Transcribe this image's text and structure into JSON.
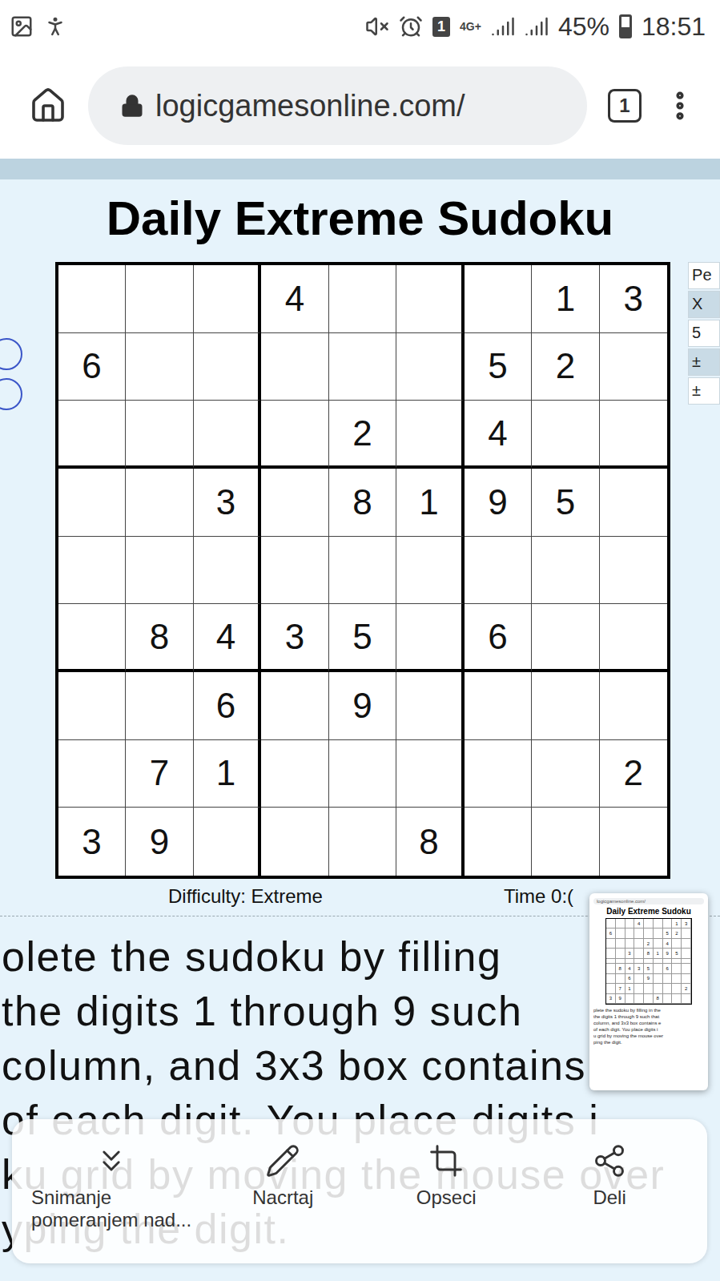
{
  "status_bar": {
    "sim_badge": "1",
    "network": "4G+",
    "battery": "45%",
    "time": "18:51"
  },
  "browser": {
    "url": "logicgamesonline.com/",
    "tab_count": "1"
  },
  "page": {
    "title": "Daily Extreme Sudoku",
    "side_panel": [
      "Pe",
      "X",
      "5",
      "±",
      "±"
    ],
    "difficulty": "Difficulty: Extreme",
    "time": "Time 0:("
  },
  "board": {
    "rows": [
      [
        "",
        "",
        "",
        "4",
        "",
        "",
        "",
        "1",
        "3"
      ],
      [
        "6",
        "",
        "",
        "",
        "",
        "",
        "5",
        "2",
        ""
      ],
      [
        "",
        "",
        "",
        "",
        "2",
        "",
        "4",
        "",
        ""
      ],
      [
        "",
        "",
        "3",
        "",
        "8",
        "1",
        "9",
        "5",
        ""
      ],
      [
        "",
        "",
        "",
        "",
        "",
        "",
        "",
        "",
        ""
      ],
      [
        "",
        "8",
        "4",
        "3",
        "5",
        "",
        "6",
        "",
        ""
      ],
      [
        "",
        "",
        "6",
        "",
        "9",
        "",
        "",
        "",
        ""
      ],
      [
        "",
        "7",
        "1",
        "",
        "",
        "",
        "",
        "",
        "2"
      ],
      [
        "3",
        "9",
        "",
        "",
        "",
        "8",
        "",
        "",
        ""
      ]
    ]
  },
  "instructions": [
    "olete the sudoku by filling",
    "the digits 1 through 9 such",
    "column, and 3x3 box contains e",
    "of each digit. You place digits i",
    "ku grid by moving the mouse over",
    "yping the digit."
  ],
  "screenshot_preview": {
    "title": "Daily Extreme Sudoku",
    "lines": [
      "plete the sudoku by filling in the",
      "the digits 1 through 9 such that",
      "column, and 3x3 box contains e",
      "of each digit. You place digits i",
      "u grid by moving the mouse over",
      "ping the digit."
    ]
  },
  "share_toolbar": {
    "items": [
      {
        "kind": "scroll-capture",
        "label": "Snimanje",
        "sublabel": "pomeranjem nad..."
      },
      {
        "kind": "draw",
        "label": "Nacrtaj",
        "sublabel": ""
      },
      {
        "kind": "crop",
        "label": "Opseci",
        "sublabel": ""
      },
      {
        "kind": "share",
        "label": "Deli",
        "sublabel": ""
      }
    ]
  }
}
